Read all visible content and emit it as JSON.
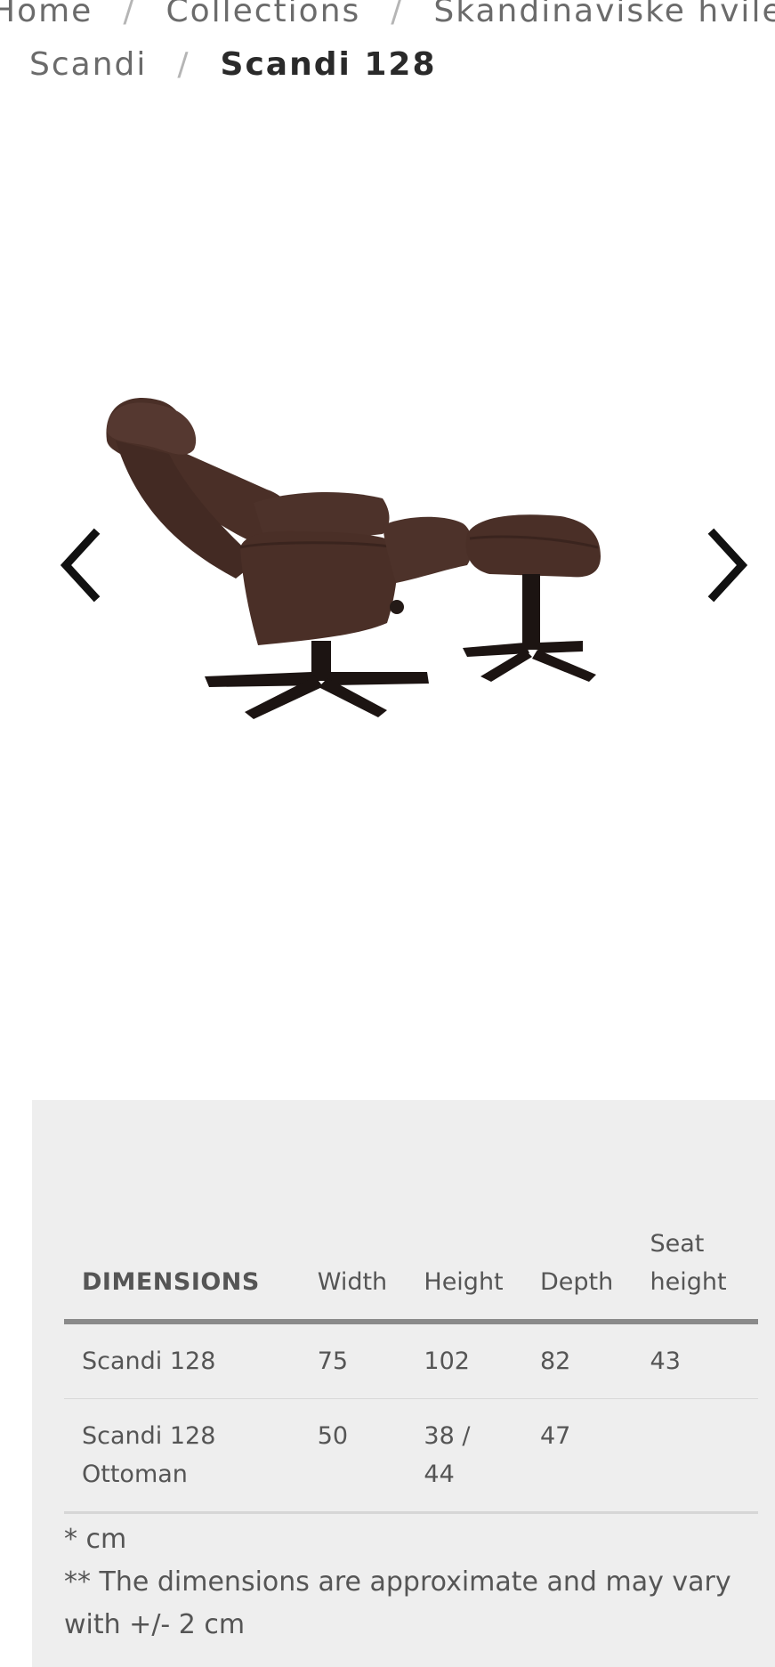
{
  "breadcrumb": {
    "items": [
      {
        "label": "Home"
      },
      {
        "label": "Collections"
      },
      {
        "label": "Skandinaviske hvilestoler"
      },
      {
        "label": "Scandi"
      },
      {
        "label": "Scandi 128"
      }
    ],
    "separator": "/"
  },
  "carousel": {
    "prev_icon": "chevron-left-icon",
    "next_icon": "chevron-right-icon",
    "image_alt": "Scandi 128"
  },
  "dimensions": {
    "headers": {
      "name": "DIMENSIONS",
      "width": "Width",
      "height": "Height",
      "depth": "Depth",
      "seat_height": "Seat height"
    },
    "rows": [
      {
        "name": "Scandi 128",
        "width": "75",
        "height": "102",
        "depth": "82",
        "seat_height": "43"
      },
      {
        "name": "Scandi 128 Ottoman",
        "width": "50",
        "height": "38 / 44",
        "depth": "47",
        "seat_height": ""
      }
    ],
    "notes": [
      "* cm",
      "** The dimensions are approximate and may vary with +/- 2 cm"
    ]
  },
  "colors": {
    "panel_bg": "#eeeeee",
    "header_rule": "#8a8a8a",
    "upholstery": "#4a2f27",
    "base": "#1c1412"
  }
}
